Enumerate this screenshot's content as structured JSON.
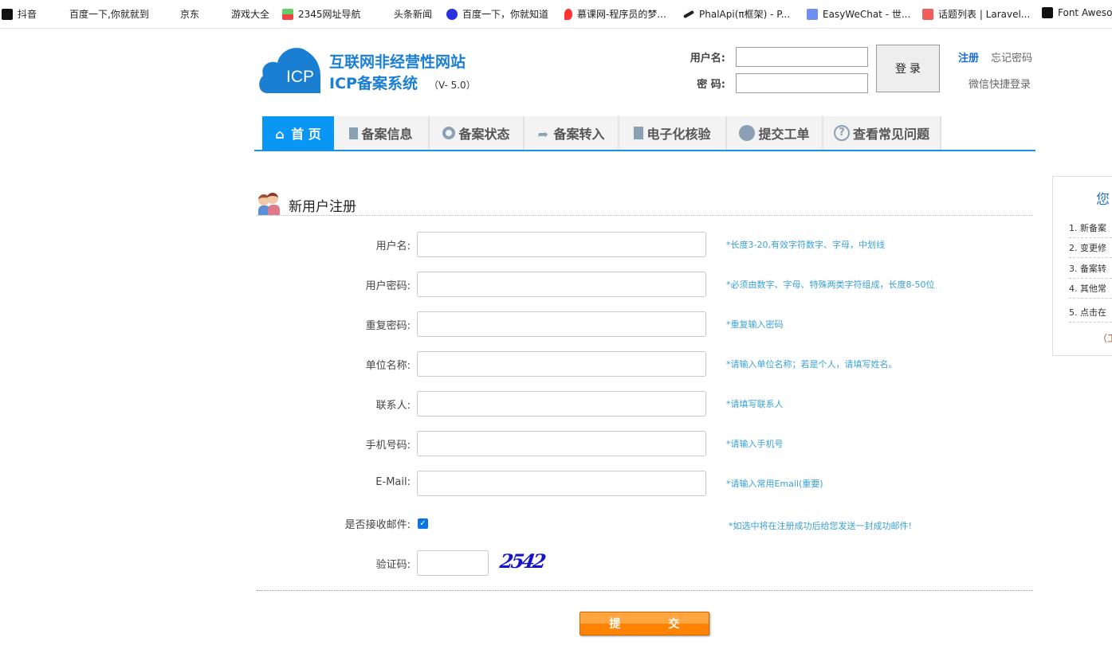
{
  "bookmarks": [
    {
      "label": "抖音",
      "icon": "tiktok-icon"
    },
    {
      "label": "百度一下,你就就到",
      "icon": ""
    },
    {
      "label": "京东",
      "icon": ""
    },
    {
      "label": "游戏大全",
      "icon": ""
    },
    {
      "label": "2345网址导航",
      "icon": "house-2345-icon"
    },
    {
      "label": "头条新闻",
      "icon": ""
    },
    {
      "label": "百度一下，你就知道",
      "icon": "baidu-paw-icon"
    },
    {
      "label": "慕课网-程序员的梦...",
      "icon": "flame-icon"
    },
    {
      "label": "PhalApi(π框架) - P...",
      "icon": "phalapi-icon"
    },
    {
      "label": "EasyWeChat - 世...",
      "icon": "easywechat-icon"
    },
    {
      "label": "话题列表 | Laravel...",
      "icon": "laravel-icon"
    },
    {
      "label": "Font Awesome",
      "icon": "flag-icon"
    }
  ],
  "logo": {
    "badge": "ICP",
    "line1": "互联网非经营性网站",
    "line2": "ICP备案系统",
    "version": "（V- 5.0）"
  },
  "login": {
    "username_label": "用户名:",
    "password_label": "密  码:",
    "username_value": "",
    "password_value": "",
    "button": "登 录",
    "register": "注册",
    "forgot": "忘记密码",
    "wechat": "微信快捷登录"
  },
  "nav": [
    {
      "label": "首 页",
      "icon": "home-icon",
      "active": true
    },
    {
      "label": "备案信息",
      "icon": "document-icon"
    },
    {
      "label": "备案状态",
      "icon": "lifebuoy-icon"
    },
    {
      "label": "备案转入",
      "icon": "share-arrow-icon"
    },
    {
      "label": "电子化核验",
      "icon": "clipboard-icon"
    },
    {
      "label": "提交工单",
      "icon": "user-icon"
    },
    {
      "label": "查看常见问题",
      "icon": "question-icon"
    }
  ],
  "section_title": "新用户注册",
  "form": {
    "fields": [
      {
        "label": "用户名:",
        "value": "",
        "hint": "*长度3-20,有效字符数字、字母，中划线"
      },
      {
        "label": "用户密码:",
        "value": "",
        "hint": "*必须由数字、字母、特殊两类字符组成，长度8-50位"
      },
      {
        "label": "重复密码:",
        "value": "",
        "hint": "*重复输入密码"
      },
      {
        "label": "单位名称:",
        "value": "",
        "hint": "*请输入单位名称；若是个人，请填写姓名。"
      },
      {
        "label": "联系人:",
        "value": "",
        "hint": "*请填写联系人"
      },
      {
        "label": "手机号码:",
        "value": "",
        "hint": "*请输入手机号"
      },
      {
        "label": "E-Mail:",
        "value": "",
        "hint": "*请输入常用Email(重要)"
      }
    ],
    "email_opt_label": "是否接收邮件:",
    "email_opt_checked": true,
    "email_opt_hint": "*如选中将在注册成功后给您发送一封成功邮件!",
    "captcha_label": "验证码:",
    "captcha_value": "",
    "captcha_text": "2542",
    "submit": "提 交"
  },
  "side": {
    "title": "您",
    "items": [
      "1.  新备案",
      "2.  变更修",
      "3.  备案转",
      "4.  其他常",
      "5.  点击在"
    ],
    "footer": "（工"
  }
}
